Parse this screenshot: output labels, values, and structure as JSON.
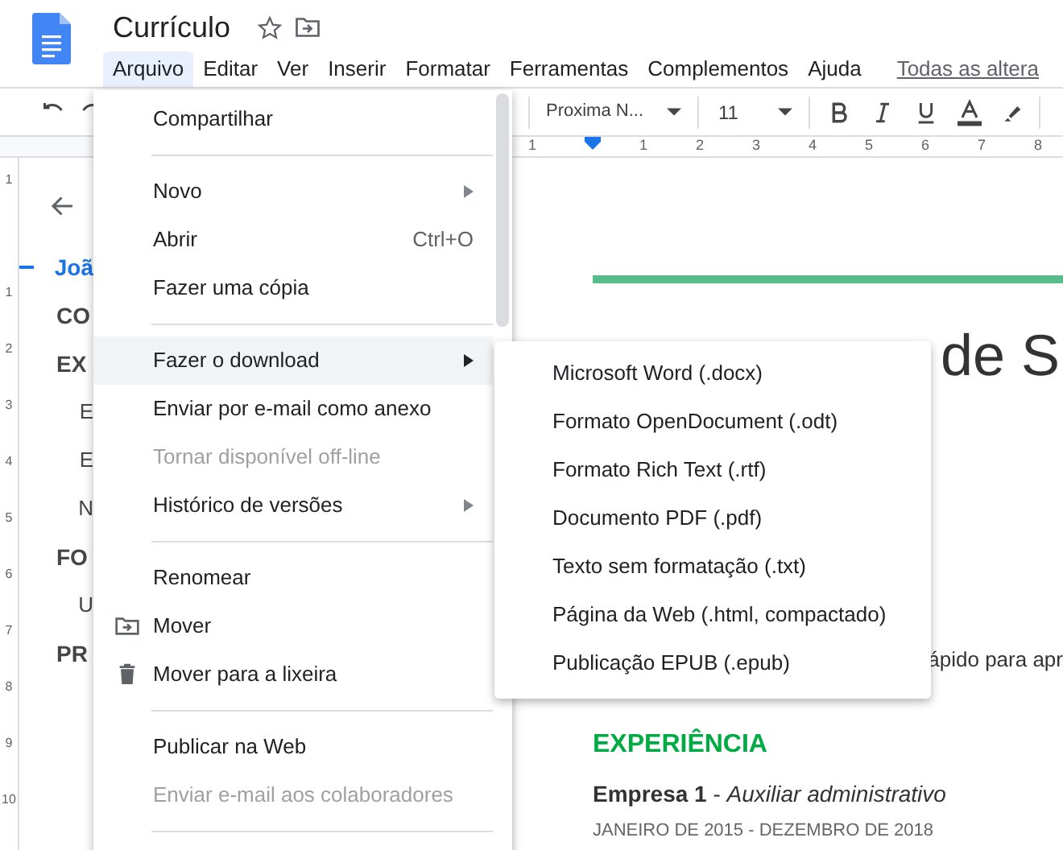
{
  "document": {
    "title": "Currículo"
  },
  "menubar": [
    {
      "label": "Arquivo",
      "selected": true
    },
    {
      "label": "Editar",
      "selected": false
    },
    {
      "label": "Ver",
      "selected": false
    },
    {
      "label": "Inserir",
      "selected": false
    },
    {
      "label": "Formatar",
      "selected": false
    },
    {
      "label": "Ferramentas",
      "selected": false
    },
    {
      "label": "Complementos",
      "selected": false
    },
    {
      "label": "Ajuda",
      "selected": false
    }
  ],
  "changes_link": "Todas as altera",
  "toolbar": {
    "font": "Proxima N...",
    "font_size": "11"
  },
  "ruler": [
    "1",
    "1",
    "2",
    "3",
    "4",
    "5",
    "6",
    "7",
    "8"
  ],
  "vertical_ruler": [
    "1",
    "1",
    "2",
    "3",
    "4",
    "5",
    "6",
    "7",
    "8",
    "9",
    "10"
  ],
  "outline": [
    {
      "text": "Joã",
      "selected": true
    },
    {
      "text": "CO",
      "selected": false
    },
    {
      "text": "EX",
      "selected": false,
      "children": [
        {
          "text": "E",
          "selected": false
        },
        {
          "text": "E",
          "selected": false
        },
        {
          "text": "N",
          "selected": false
        }
      ]
    },
    {
      "text": "FO",
      "selected": false,
      "children": [
        {
          "text": "U",
          "selected": false
        }
      ]
    },
    {
      "text": "PR",
      "selected": false
    }
  ],
  "file_menu": [
    {
      "kind": "item",
      "label": "Compartilhar",
      "submenu": false,
      "selected": false,
      "disabled": false
    },
    {
      "kind": "separator"
    },
    {
      "kind": "item",
      "label": "Novo",
      "submenu": true,
      "selected": false,
      "disabled": false
    },
    {
      "kind": "item",
      "label": "Abrir",
      "shortcut": "Ctrl+O",
      "submenu": false,
      "selected": false,
      "disabled": false
    },
    {
      "kind": "item",
      "label": "Fazer uma cópia",
      "submenu": false,
      "selected": false,
      "disabled": false
    },
    {
      "kind": "separator"
    },
    {
      "kind": "item",
      "label": "Fazer o download",
      "submenu": true,
      "selected": true,
      "disabled": false
    },
    {
      "kind": "item",
      "label": "Enviar por e-mail como anexo",
      "submenu": false,
      "selected": false,
      "disabled": false
    },
    {
      "kind": "item",
      "label": "Tornar disponível off-line",
      "submenu": false,
      "selected": false,
      "disabled": true
    },
    {
      "kind": "item",
      "label": "Histórico de versões",
      "submenu": true,
      "selected": false,
      "disabled": false
    },
    {
      "kind": "separator"
    },
    {
      "kind": "item",
      "label": "Renomear",
      "submenu": false,
      "selected": false,
      "disabled": false
    },
    {
      "kind": "folder-item",
      "label": "Mover",
      "submenu": false,
      "selected": false,
      "disabled": false
    },
    {
      "kind": "trash-item",
      "label": "Mover para a lixeira",
      "submenu": false,
      "selected": false,
      "disabled": false
    },
    {
      "kind": "separator"
    },
    {
      "kind": "item",
      "label": "Publicar na Web",
      "submenu": false,
      "selected": false,
      "disabled": false
    },
    {
      "kind": "item",
      "label": "Enviar e-mail aos colaboradores",
      "submenu": false,
      "selected": false,
      "disabled": true
    },
    {
      "kind": "separator"
    }
  ],
  "download_menu": [
    "Microsoft Word (.docx)",
    "Formato OpenDocument (.odt)",
    "Formato Rich Text (.rtf)",
    "Documento PDF (.pdf)",
    "Texto sem formatação (.txt)",
    "Página da Web (.html, compactado)",
    "Publicação EPUB (.epub)"
  ],
  "page": {
    "heading": "de S",
    "paragraph": "ápido para apr",
    "section_title": "EXPERIÊNCIA",
    "job": "**Empresa 1** - *Auxiliar administrativo*",
    "dates": "JANEIRO DE 2015 - DEZEMBRO DE 2018"
  }
}
